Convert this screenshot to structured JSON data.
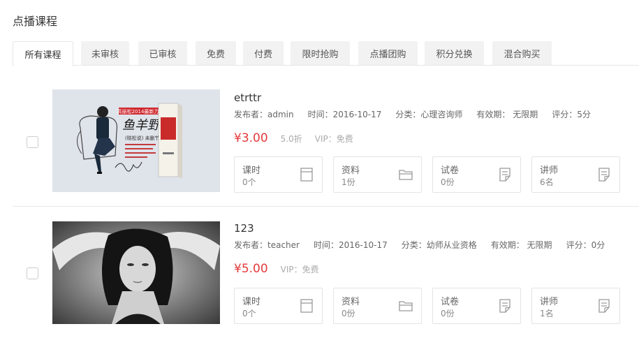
{
  "page": {
    "title": "点播课程"
  },
  "tabs": [
    "所有课程",
    "未审核",
    "已审核",
    "免费",
    "付费",
    "限时抢购",
    "点播团购",
    "积分兑换",
    "混合购买"
  ],
  "courses": [
    {
      "title": "etrttr",
      "publisher": "发布者：admin",
      "time": "时间：2016-10-17",
      "category": "分类：心理咨询师",
      "validity": "有效期： 无限期",
      "rating": "评分：5分",
      "price": "¥3.00",
      "discount": "5.0折",
      "vip": "VIP：免费",
      "thumb_text": {
        "top": "高丽松2014最新力作",
        "big": "鱼羊野史",
        "sub": "(晓松说) 未删节版"
      },
      "stats": [
        {
          "label": "课时",
          "value": "0个",
          "icon": "book-icon"
        },
        {
          "label": "资料",
          "value": "1份",
          "icon": "folder-icon"
        },
        {
          "label": "试卷",
          "value": "0份",
          "icon": "paper-edit-icon"
        },
        {
          "label": "讲师",
          "value": "6名",
          "icon": "paper-edit-icon"
        }
      ]
    },
    {
      "title": "123",
      "publisher": "发布者：teacher",
      "time": "时间：2016-10-17",
      "category": "分类：幼师从业资格",
      "validity": "有效期： 无限期",
      "rating": "评分：0分",
      "price": "¥5.00",
      "vip": "VIP：免费",
      "stats": [
        {
          "label": "课时",
          "value": "0个",
          "icon": "book-icon"
        },
        {
          "label": "资料",
          "value": "0份",
          "icon": "folder-icon"
        },
        {
          "label": "试卷",
          "value": "0份",
          "icon": "paper-edit-icon"
        },
        {
          "label": "讲师",
          "value": "1名",
          "icon": "paper-edit-icon"
        }
      ]
    }
  ],
  "colors": {
    "price": "#e4393c",
    "tab_bg": "#f2f2f2",
    "border": "#e3e3e3"
  }
}
